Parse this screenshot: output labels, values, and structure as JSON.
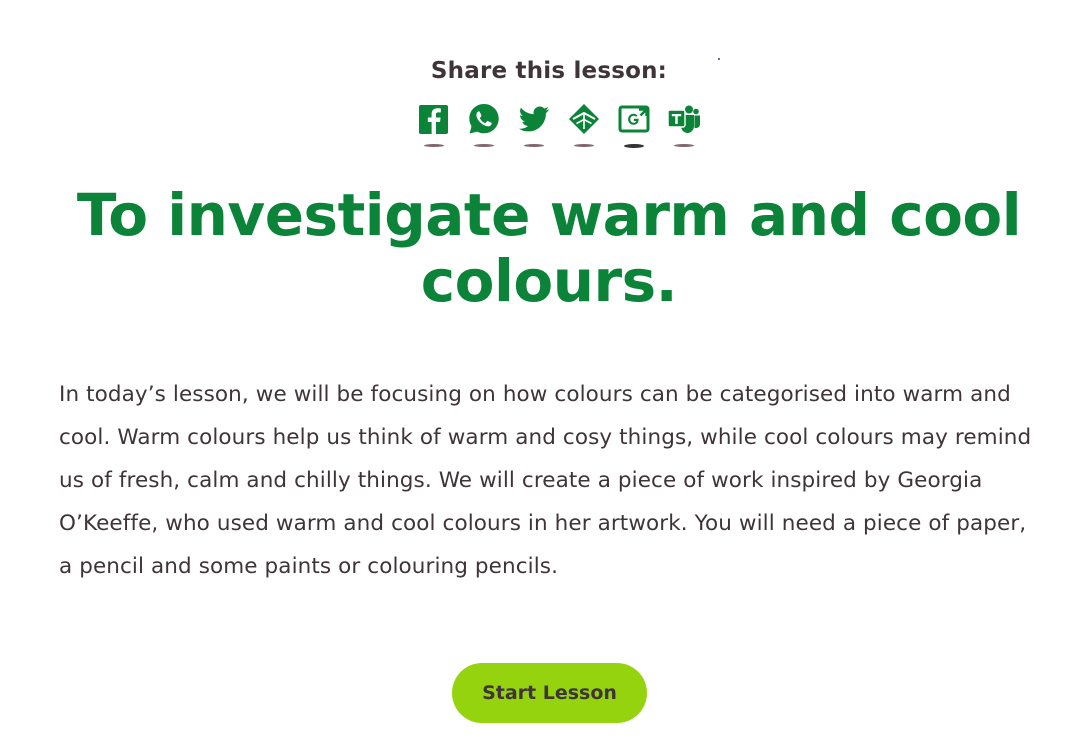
{
  "share": {
    "heading": "Share this lesson:",
    "buttons": [
      {
        "name": "facebook",
        "icon": "facebook-icon"
      },
      {
        "name": "whatsapp",
        "icon": "whatsapp-icon"
      },
      {
        "name": "twitter",
        "icon": "twitter-icon"
      },
      {
        "name": "email",
        "icon": "email-icon"
      },
      {
        "name": "google-classroom",
        "icon": "google-classroom-icon"
      },
      {
        "name": "microsoft-teams",
        "icon": "microsoft-teams-icon"
      }
    ],
    "icon_color": "#0b8338"
  },
  "lesson": {
    "title": "To investigate warm and cool colours.",
    "description": "In today’s lesson, we will be focusing on how colours can be categorised into warm and cool. Warm colours help us think of warm and cosy things, while cool colours may remind us of fresh, calm and chilly things. We will create a piece of work inspired by Georgia O’Keeffe, who used warm and cool colours in her artwork. You will need a piece of paper, a pencil and some paints or colouring pencils.",
    "start_button_label": "Start Lesson"
  },
  "colors": {
    "title_green": "#0b8338",
    "button_green": "#95d30f",
    "text": "#3f3437"
  }
}
